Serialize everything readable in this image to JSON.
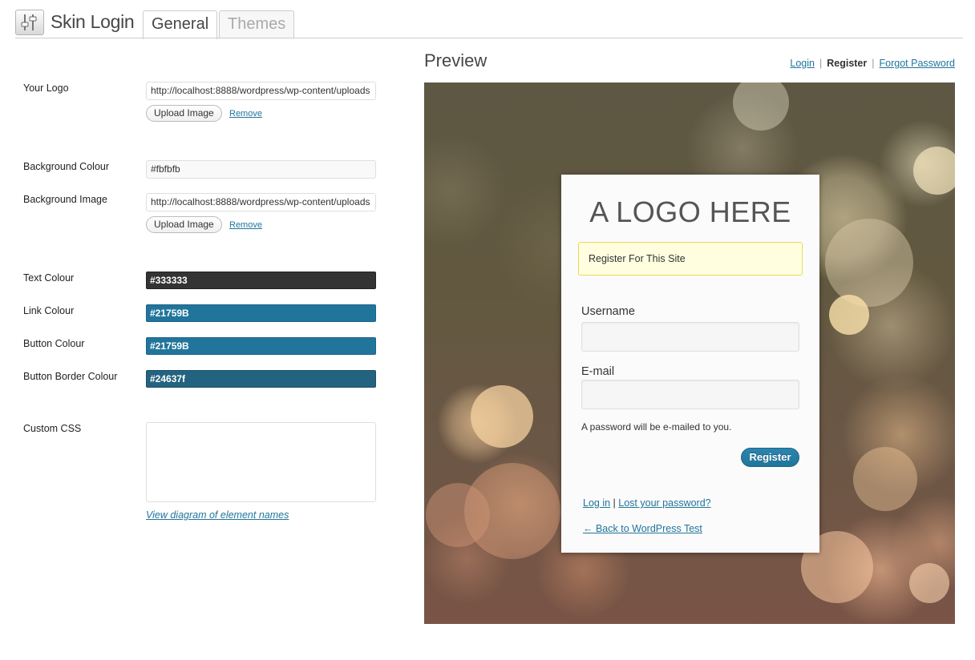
{
  "header": {
    "title": "Skin Login",
    "tabs": [
      {
        "label": "General",
        "active": true
      },
      {
        "label": "Themes",
        "active": false
      }
    ]
  },
  "settings": {
    "your_logo": {
      "label": "Your Logo",
      "value": "http://localhost:8888/wordpress/wp-content/uploads",
      "upload_label": "Upload Image",
      "remove_label": "Remove"
    },
    "background_colour": {
      "label": "Background Colour",
      "value": "#fbfbfb"
    },
    "background_image": {
      "label": "Background Image",
      "value": "http://localhost:8888/wordpress/wp-content/uploads",
      "upload_label": "Upload Image",
      "remove_label": "Remove"
    },
    "text_colour": {
      "label": "Text Colour",
      "value": "#333333"
    },
    "link_colour": {
      "label": "Link Colour",
      "value": "#21759B"
    },
    "button_colour": {
      "label": "Button Colour",
      "value": "#21759B"
    },
    "button_border_colour": {
      "label": "Button Border Colour",
      "value": "#24637f"
    },
    "custom_css": {
      "label": "Custom CSS",
      "value": ""
    },
    "diagram_link": "View diagram of element names"
  },
  "preview": {
    "title": "Preview",
    "nav": {
      "login": "Login",
      "register": "Register",
      "forgot": "Forgot Password",
      "separator": "|"
    },
    "card": {
      "logo_text": "A LOGO HERE",
      "notice": "Register For This Site",
      "username_label": "Username",
      "email_label": "E-mail",
      "hint": "A password will be e-mailed to you.",
      "register_button": "Register",
      "login_link": "Log in",
      "link_separator": "|",
      "lost_password_link": "Lost your password?",
      "back_link": "← Back to WordPress Test"
    }
  },
  "colors": {
    "text": "#333333",
    "link": "#21759B",
    "button": "#21759B",
    "button_border": "#24637f",
    "background": "#fbfbfb",
    "notice_bg": "#ffffe0",
    "notice_border": "#e6db55"
  },
  "icons": {
    "app": "sliders-icon",
    "resize": "resize-grip-icon"
  }
}
